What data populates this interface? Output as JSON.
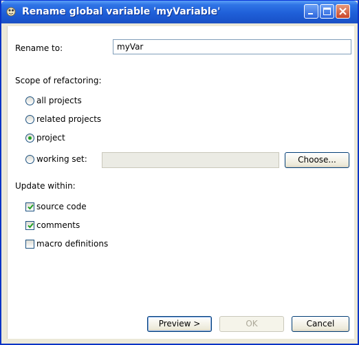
{
  "window": {
    "title": "Rename global variable 'myVariable'",
    "controls": {
      "minimize_icon": "minimize-icon",
      "maximize_icon": "maximize-icon",
      "close_icon": "close-icon"
    }
  },
  "rename": {
    "label": "Rename to:",
    "value": "myVar"
  },
  "scope": {
    "heading": "Scope of refactoring:",
    "options": [
      {
        "label": "all projects",
        "selected": false
      },
      {
        "label": "related projects",
        "selected": false
      },
      {
        "label": "project",
        "selected": true
      },
      {
        "label": "working set:",
        "selected": false
      }
    ],
    "working_set_value": "",
    "choose_label": "Choose..."
  },
  "update": {
    "heading": "Update within:",
    "options": [
      {
        "label": "source code",
        "checked": true
      },
      {
        "label": "comments",
        "checked": true
      },
      {
        "label": "macro definitions",
        "checked": false
      }
    ]
  },
  "buttons": {
    "preview": "Preview >",
    "ok": "OK",
    "cancel": "Cancel"
  }
}
